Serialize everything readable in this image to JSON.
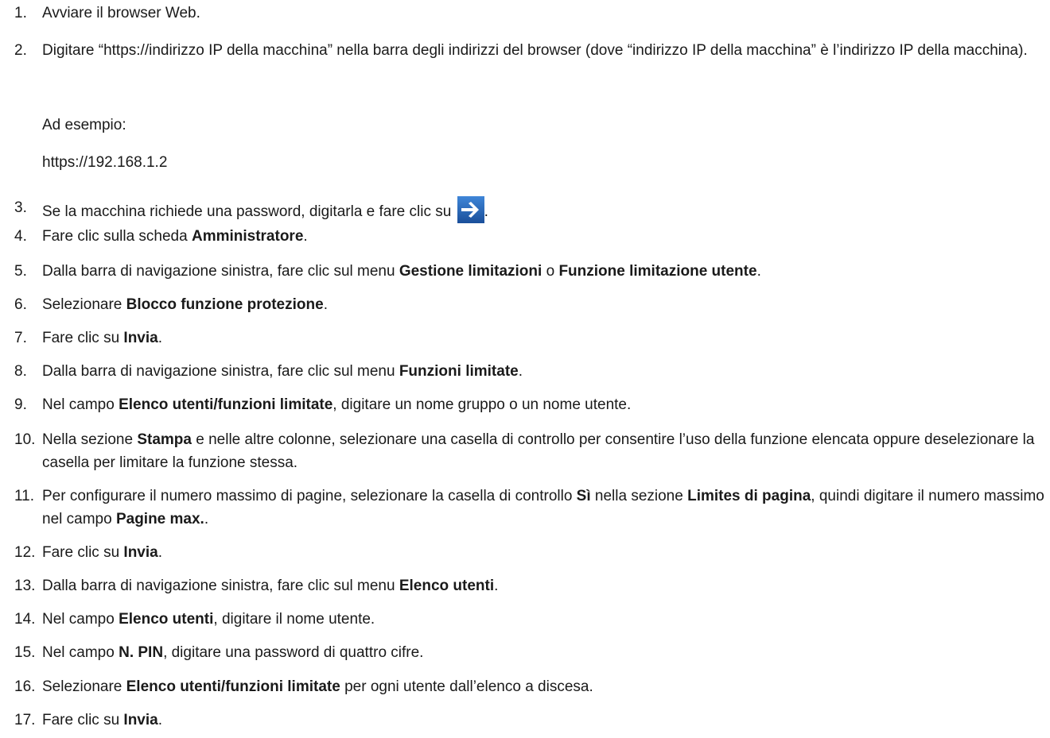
{
  "steps": [
    {
      "num": "1.",
      "segments": [
        {
          "text": "Avviare il browser Web."
        }
      ]
    },
    {
      "num": "2.",
      "segments": [
        {
          "text": "Digitare “https://indirizzo IP della macchina” nella barra degli indirizzi del browser (dove “indirizzo IP della macchina” è l’indirizzo IP della macchina)."
        }
      ]
    },
    {
      "num": "3.",
      "before": "Se la macchina richiede una password, digitarla e fare clic su ",
      "after": "."
    },
    {
      "num": "4.",
      "segments": [
        {
          "text": "Fare clic sulla scheda "
        },
        {
          "text": "Amministratore",
          "bold": true
        },
        {
          "text": "."
        }
      ]
    },
    {
      "num": "5.",
      "segments": [
        {
          "text": "Dalla barra di navigazione sinistra, fare clic sul menu "
        },
        {
          "text": "Gestione limitazioni",
          "bold": true
        },
        {
          "text": " o "
        },
        {
          "text": "Funzione limitazione utente",
          "bold": true
        },
        {
          "text": "."
        }
      ]
    },
    {
      "num": "6.",
      "segments": [
        {
          "text": "Selezionare "
        },
        {
          "text": "Blocco funzione protezione",
          "bold": true
        },
        {
          "text": "."
        }
      ]
    },
    {
      "num": "7.",
      "segments": [
        {
          "text": "Fare clic su "
        },
        {
          "text": "Invia",
          "bold": true
        },
        {
          "text": "."
        }
      ]
    },
    {
      "num": "8.",
      "segments": [
        {
          "text": "Dalla barra di navigazione sinistra, fare clic sul menu "
        },
        {
          "text": "Funzioni limitate",
          "bold": true
        },
        {
          "text": "."
        }
      ]
    },
    {
      "num": "9.",
      "segments": [
        {
          "text": "Nel campo "
        },
        {
          "text": "Elenco utenti/funzioni limitate",
          "bold": true
        },
        {
          "text": ", digitare un nome gruppo o un nome utente."
        }
      ]
    },
    {
      "num": "10.",
      "segments": [
        {
          "text": "Nella sezione "
        },
        {
          "text": "Stampa",
          "bold": true
        },
        {
          "text": " e nelle altre colonne, selezionare una casella di controllo per consentire l’uso della funzione elencata oppure deselezionare la casella per limitare la funzione stessa."
        }
      ]
    },
    {
      "num": "11.",
      "segments": [
        {
          "text": "Per configurare il numero massimo di pagine, selezionare la casella di controllo "
        },
        {
          "text": "Sì",
          "bold": true
        },
        {
          "text": " nella sezione "
        },
        {
          "text": "Limites di pagina",
          "bold": true
        },
        {
          "text": ", quindi digitare il numero massimo nel campo "
        },
        {
          "text": "Pagine max.",
          "bold": true
        },
        {
          "text": "."
        }
      ]
    },
    {
      "num": "12.",
      "segments": [
        {
          "text": "Fare clic su "
        },
        {
          "text": "Invia",
          "bold": true
        },
        {
          "text": "."
        }
      ]
    },
    {
      "num": "13.",
      "segments": [
        {
          "text": "Dalla barra di navigazione sinistra, fare clic sul menu "
        },
        {
          "text": "Elenco utenti",
          "bold": true
        },
        {
          "text": "."
        }
      ]
    },
    {
      "num": "14.",
      "segments": [
        {
          "text": "Nel campo "
        },
        {
          "text": "Elenco utenti",
          "bold": true
        },
        {
          "text": ", digitare il nome utente."
        }
      ]
    },
    {
      "num": "15.",
      "segments": [
        {
          "text": "Nel campo "
        },
        {
          "text": "N. PIN",
          "bold": true
        },
        {
          "text": ", digitare una password di quattro cifre."
        }
      ]
    },
    {
      "num": "16.",
      "segments": [
        {
          "text": "Selezionare "
        },
        {
          "text": "Elenco utenti/funzioni limitate",
          "bold": true
        },
        {
          "text": " per ogni utente dall’elenco a discesa."
        }
      ]
    },
    {
      "num": "17.",
      "segments": [
        {
          "text": "Fare clic su "
        },
        {
          "text": "Invia",
          "bold": true
        },
        {
          "text": "."
        }
      ]
    }
  ],
  "example_label": "Ad esempio:",
  "example_url": "https://192.168.1.2",
  "arrow_icon": {
    "name": "go-arrow-icon",
    "color": "#1f5fae",
    "arrow_color": "#ffffff"
  }
}
